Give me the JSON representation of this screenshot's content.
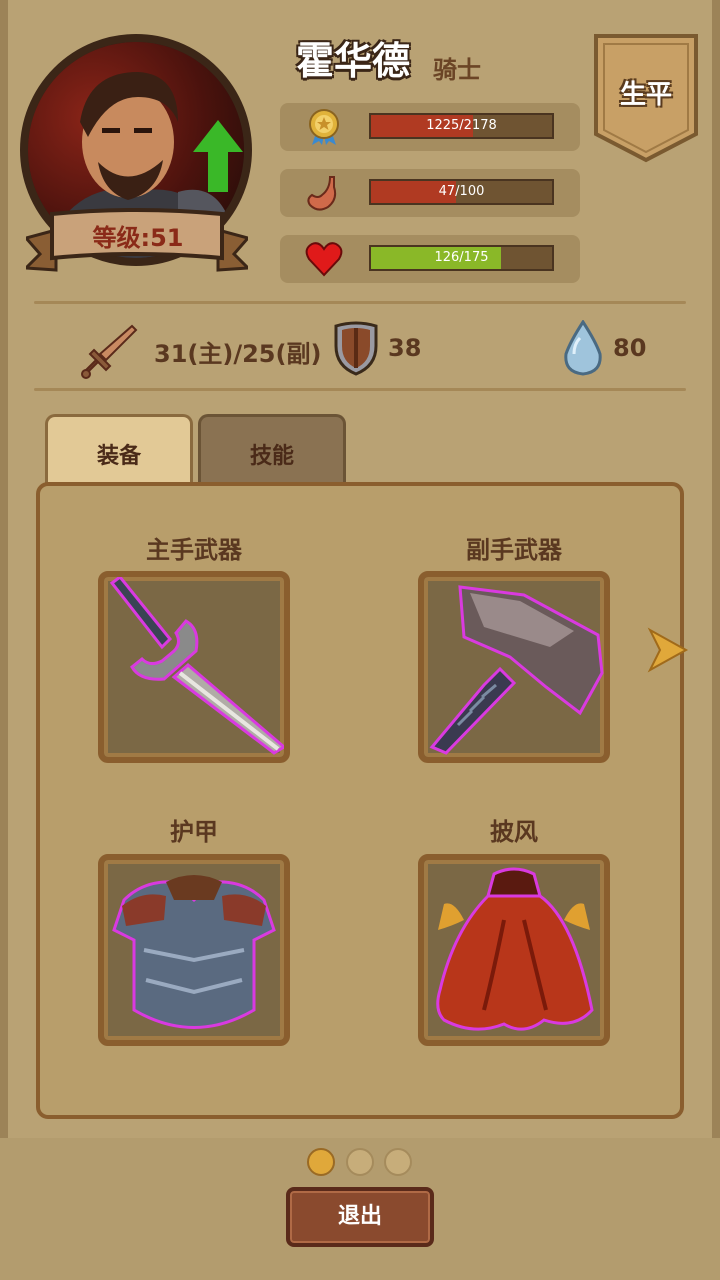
{
  "hero": {
    "name": "霍华德",
    "class": "骑士",
    "level_label": "等级:51"
  },
  "bio_button": "生平",
  "stats": {
    "experience": {
      "label": "1225/2178",
      "value": 1225,
      "max": 2178,
      "color": "#b03a22",
      "icon": "medal-icon"
    },
    "hunger": {
      "label": "47/100",
      "value": 47,
      "max": 100,
      "color": "#b03a22",
      "icon": "stomach-icon"
    },
    "health": {
      "label": "126/175",
      "value": 126,
      "max": 175,
      "color": "#8ab828",
      "icon": "heart-icon"
    }
  },
  "attributes": {
    "attack": "31(主)/25(副)",
    "defense": "38",
    "water": "80"
  },
  "tabs": [
    {
      "label": "装备",
      "active": true
    },
    {
      "label": "技能",
      "active": false
    }
  ],
  "equipment": {
    "main_weapon": {
      "label": "主手武器",
      "item_icon": "sword-icon"
    },
    "off_weapon": {
      "label": "副手武器",
      "item_icon": "hammer-icon"
    },
    "armor": {
      "label": "护甲",
      "item_icon": "chest-armor-icon"
    },
    "cloak": {
      "label": "披风",
      "item_icon": "cloak-icon"
    }
  },
  "pagination": {
    "pages": 3,
    "current": 1
  },
  "exit_button": "退出",
  "colors": {
    "rarity_glow": "#d93ae0",
    "accent": "#e0a83a"
  }
}
